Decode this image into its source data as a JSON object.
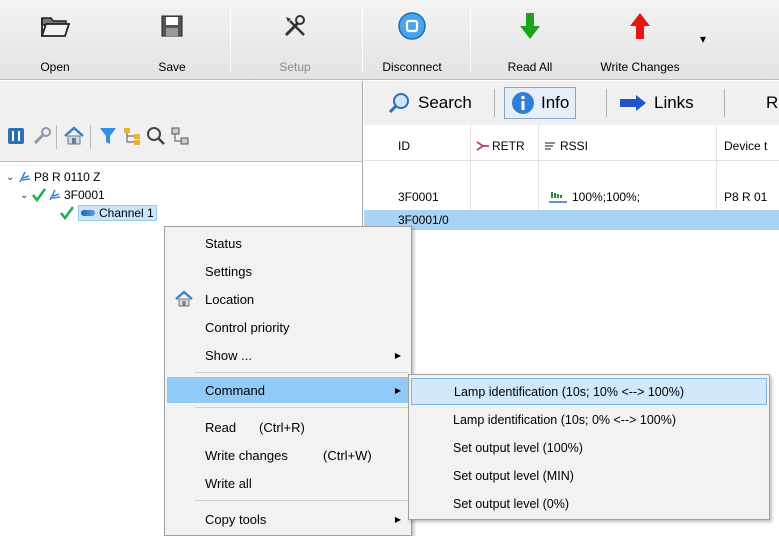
{
  "toolbar": {
    "open_label": "Open",
    "save_label": "Save",
    "setup_label": "Setup",
    "disconnect_label": "Disconnect",
    "read_all_label": "Read All",
    "write_changes_label": "Write Changes",
    "dropdown_glyph": "▾"
  },
  "tree": {
    "root_label": "P8 R 0110 Z",
    "device_label": "3F0001",
    "channel_label": "Channel 1",
    "expanded_glyph": "⌄"
  },
  "tabs": {
    "search": "Search",
    "info": "Info",
    "links": "Links",
    "partial": "R"
  },
  "grid": {
    "columns": [
      "ID",
      "RETR",
      "RSSI",
      "Device t"
    ],
    "rows": [
      {
        "id": "3F0001",
        "retr": "",
        "rssi": "100%;100%;",
        "device": "P8 R 01"
      },
      {
        "id": "3F0001/0",
        "retr": "",
        "rssi": "",
        "device": ""
      }
    ]
  },
  "context_menu": {
    "items": [
      {
        "label": "Status"
      },
      {
        "label": "Settings"
      },
      {
        "label": "Location"
      },
      {
        "label": "Control priority"
      },
      {
        "label": "Show ..."
      },
      {
        "label": "Command"
      },
      {
        "label": "Read",
        "shortcut": "(Ctrl+R)"
      },
      {
        "label": "Write changes",
        "shortcut": "(Ctrl+W)"
      },
      {
        "label": "Write all"
      },
      {
        "label": "Copy tools"
      }
    ],
    "arrow_glyph": "▶"
  },
  "submenu": {
    "items": [
      "Lamp identification (10s; 10% <--> 100%)",
      "Lamp identification (10s; 0% <--> 100%)",
      "Set output level (100%)",
      "Set output level (MIN)",
      "Set output level (0%)"
    ]
  },
  "colors": {
    "accent_selection": "#91c9f7",
    "check_green": "#22b14c",
    "read_arrow": "#1ea21e",
    "write_arrow": "#e81414"
  }
}
